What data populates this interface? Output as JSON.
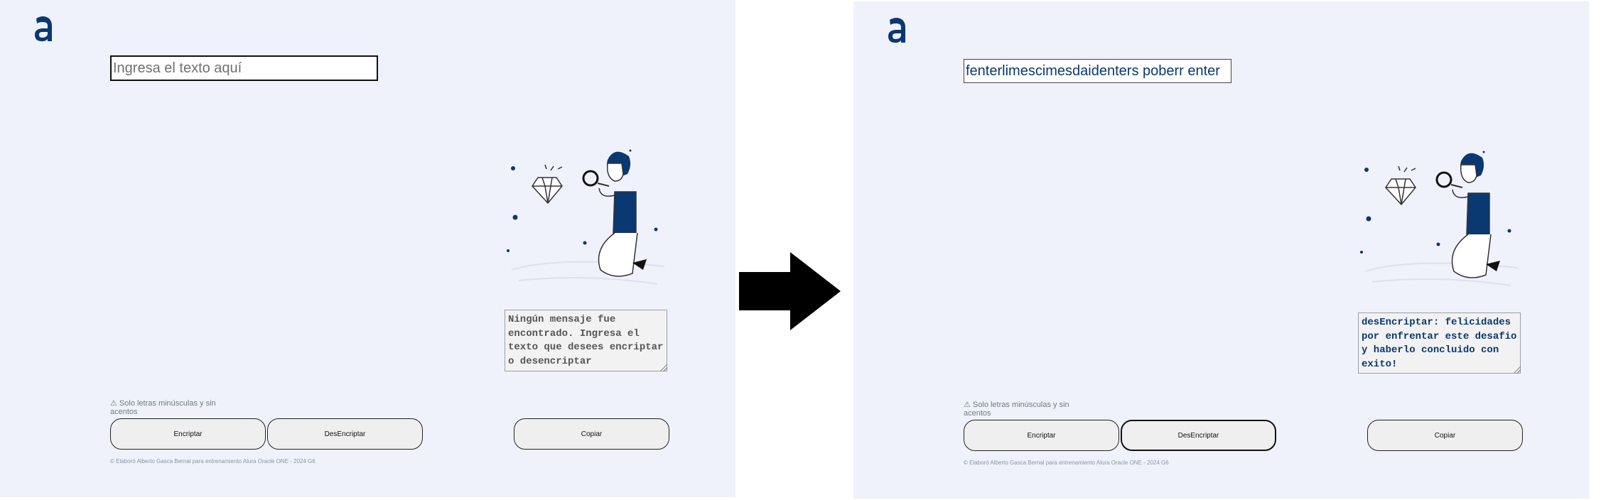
{
  "panels": [
    {
      "input": {
        "value": "",
        "placeholder": "Ingresa el texto aquí"
      },
      "output": "Ningún mensaje fue encontrado. Ingresa el texto que desees encriptar o desencriptar",
      "warning": "⚠ Solo letras minúsculas y sin acentos",
      "buttons": {
        "encrypt": "Encriptar",
        "decrypt": "DesEncriptar",
        "copy": "Copiar"
      },
      "footer": "© Elaboró Alberto Gasca Bernal para entrenamiento Alura Oracle ONE - 2024 G6"
    },
    {
      "input": {
        "value": "fenterlimescimesdaidenters poberr enter",
        "placeholder": "Ingresa el texto aquí"
      },
      "output": "desEncriptar: felicidades por enfrentar este desafio y haberlo concluido con exito!",
      "warning": "⚠ Solo letras minúsculas y sin acentos",
      "buttons": {
        "encrypt": "Encriptar",
        "decrypt": "DesEncriptar",
        "copy": "Copiar"
      },
      "footer": "© Elaboró Alberto Gasca Bernal para entrenamiento Alura Oracle ONE - 2024 G6"
    }
  ],
  "colors": {
    "brand": "#0a3871",
    "panel_bg": "#eff2fa"
  },
  "icons": {
    "logo": "alura-logo-icon",
    "illustration": "person-with-magnifier-diamond",
    "arrow": "right-arrow-icon"
  }
}
